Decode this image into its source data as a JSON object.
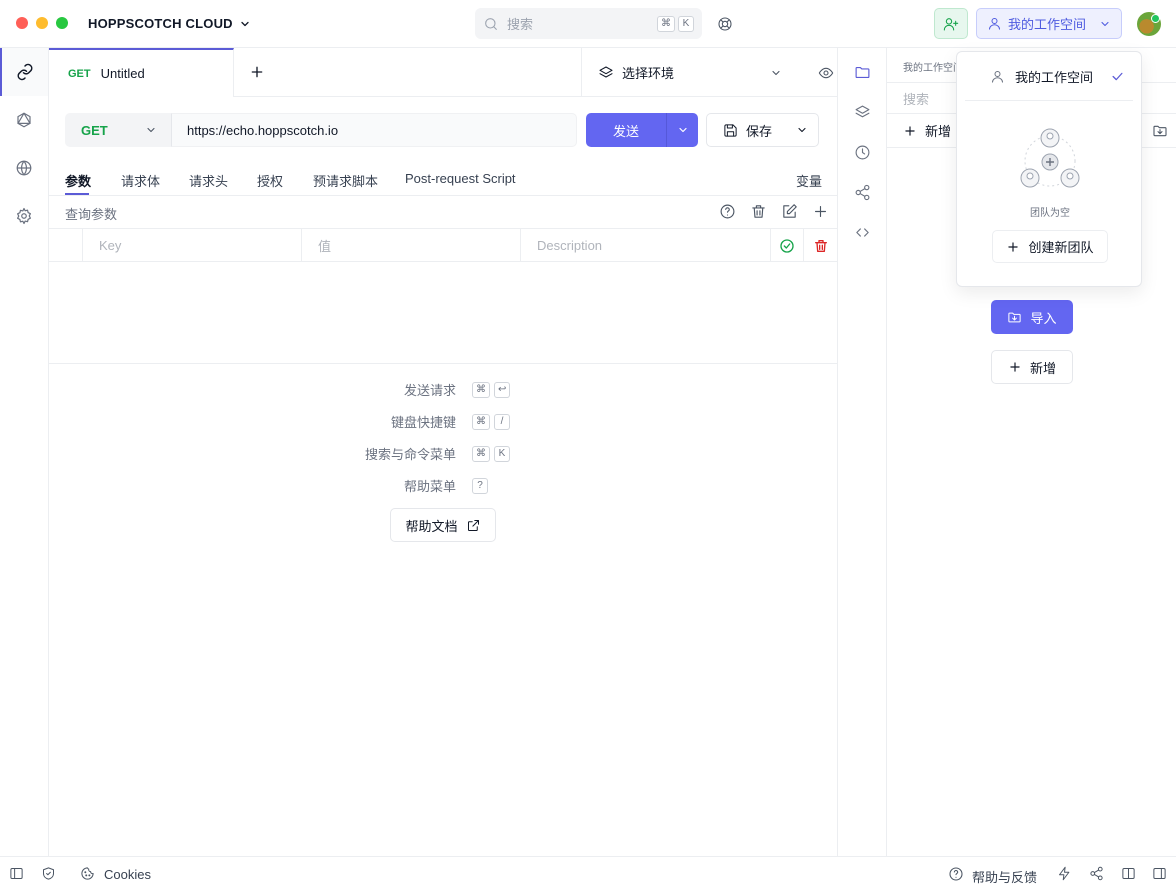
{
  "window": {
    "traffic_lights": [
      "#ff5f57",
      "#febc2e",
      "#28c840"
    ]
  },
  "header": {
    "brand": "HOPPSCOTCH CLOUD",
    "search_placeholder": "搜索",
    "search_keys": [
      "⌘",
      "K"
    ],
    "workspace_label": "我的工作空间"
  },
  "tab": {
    "method": "GET",
    "title": "Untitled"
  },
  "environment": {
    "label": "选择环境"
  },
  "request": {
    "method": "GET",
    "url": "https://echo.hoppscotch.io",
    "send_label": "发送",
    "save_label": "保存"
  },
  "param_tabs": [
    "参数",
    "请求体",
    "请求头",
    "授权",
    "预请求脚本",
    "Post-request Script"
  ],
  "variables_tab": "变量",
  "query": {
    "label": "查询参数",
    "key_placeholder": "Key",
    "value_placeholder": "值",
    "description_placeholder": "Description"
  },
  "shortcuts": [
    {
      "label": "发送请求",
      "keys": [
        "⌘",
        "↩"
      ]
    },
    {
      "label": "键盘快捷键",
      "keys": [
        "⌘",
        "/"
      ]
    },
    {
      "label": "搜索与命令菜单",
      "keys": [
        "⌘",
        "K"
      ]
    },
    {
      "label": "帮助菜单",
      "keys": [
        "?"
      ]
    }
  ],
  "docs_label": "帮助文档",
  "sidebar": {
    "header": "我的工作空间",
    "search_placeholder": "搜索",
    "new_label": "新增",
    "import_label": "导入",
    "new_button_label": "新增"
  },
  "dropdown": {
    "workspace_item": "我的工作空间",
    "empty_text": "团队为空",
    "create_team_label": "创建新团队"
  },
  "footer": {
    "cookies_label": "Cookies",
    "help_label": "帮助与反馈"
  },
  "colors": {
    "accent": "#6366f1",
    "method_get": "#16a34a",
    "danger": "#dc2626"
  }
}
